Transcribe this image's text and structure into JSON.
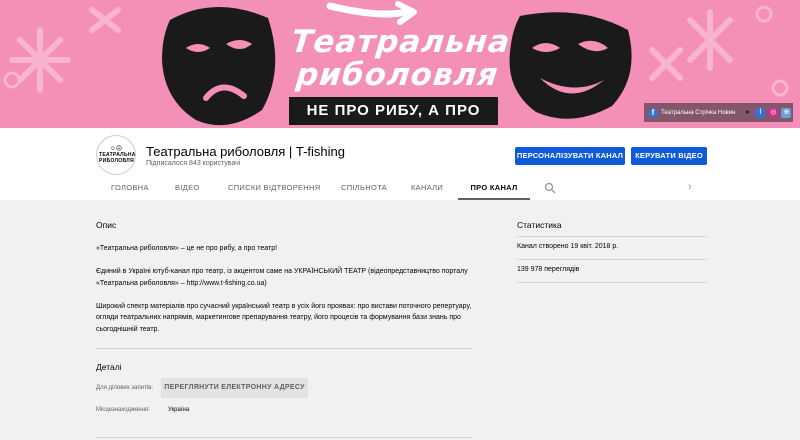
{
  "banner": {
    "title_line1": "Театральна",
    "title_line2": "риболовля",
    "subtitle": "НЕ ПРО РИБУ, А ПРО ТЕАТР",
    "links": {
      "label": "Театральна Стрічка Новин",
      "icons": [
        "facebook-icon",
        "eye-icon",
        "facebook-icon",
        "instagram-icon",
        "globe-icon"
      ]
    },
    "colors": {
      "background": "#f48fb8",
      "accent_dark": "#1a1a1a"
    }
  },
  "channel": {
    "avatar_text": "ТЕАТРАЛЬНА РИБОЛОВЛЯ",
    "name": "Театральна риболовля | T-fishing",
    "subscribers": "Підписалося 843 користувачі",
    "customize_button": "ПЕРСОНАЛІЗУВАТИ КАНАЛ",
    "manage_button": "КЕРУВАТИ ВІДЕО",
    "accent": "#0f5ad8"
  },
  "tabs": [
    "ГОЛОВНА",
    "ВІДЕО",
    "СПИСКИ ВІДТВОРЕННЯ",
    "СПІЛЬНОТА",
    "КАНАЛИ",
    "ПРО КАНАЛ"
  ],
  "active_tab": "ПРО КАНАЛ",
  "about": {
    "description_title": "Опис",
    "paragraphs": [
      "«Театральна риболовля» – це не про рибу, а про театр!",
      "Єдиний в Україні ютуб-канал про театр, із акцентом саме на УКРАЇНСЬКИЙ ТЕАТР (відеопредставництво порталу «Театральна риболовля» – http://www.t-fishing.co.ua)",
      "Широкий спектр матеріалів про сучасний український театр в усіх його проявах: про вистави поточного репертуару, огляди театральних напрямів, маркетингове препарування театру, його процесів та формування бази знань про сьогоднішній театр."
    ],
    "details_title": "Деталі",
    "business_label": "Для ділових запитів:",
    "email_button": "ПЕРЕГЛЯНУТИ ЕЛЕКТРОННУ АДРЕСУ",
    "location_label": "Місцезнаходження:",
    "location_value": "Україна"
  },
  "stats": {
    "title": "Статистика",
    "created": "Канал створено 19 квіт. 2018 р.",
    "views": "139 978 переглядів"
  }
}
